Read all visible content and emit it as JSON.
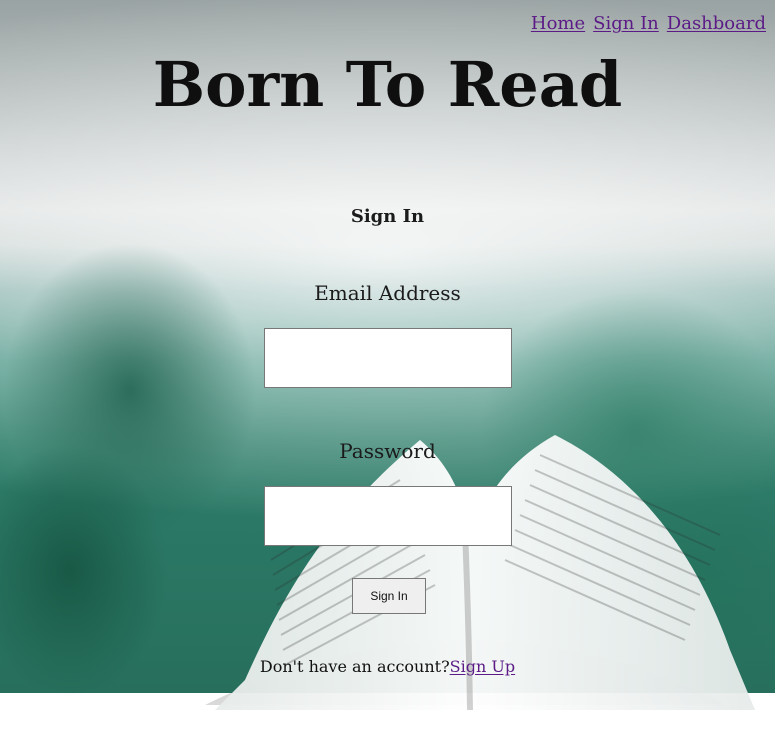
{
  "nav": {
    "items": [
      {
        "label": "Home"
      },
      {
        "label": "Sign In"
      },
      {
        "label": "Dashboard"
      }
    ]
  },
  "brand": {
    "title": "Born To Read"
  },
  "sign_in_form": {
    "title": "Sign In",
    "email": {
      "label": "Email Address",
      "value": "",
      "placeholder": ""
    },
    "password": {
      "label": "Password",
      "value": "",
      "placeholder": ""
    },
    "submit_label": "Sign In"
  },
  "signup_prompt": {
    "text": "Don't have an account?",
    "link_label": "Sign Up"
  }
}
